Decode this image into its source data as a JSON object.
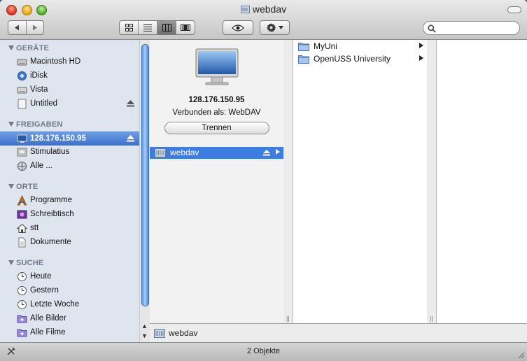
{
  "window": {
    "title": "webdav"
  },
  "toolbar": {
    "back": "back",
    "forward": "forward",
    "views": [
      "icon-view",
      "list-view",
      "column-view",
      "coverflow-view"
    ],
    "active_view": "column-view",
    "search_placeholder": ""
  },
  "sidebar": {
    "sections": [
      {
        "title": "GERÄTE",
        "items": [
          {
            "label": "Macintosh HD",
            "icon": "hard-drive-icon"
          },
          {
            "label": "iDisk",
            "icon": "idisk-icon"
          },
          {
            "label": "Vista",
            "icon": "disk-icon"
          },
          {
            "label": "Untitled",
            "icon": "disk-icon",
            "eject": true
          }
        ]
      },
      {
        "title": "FREIGABEN",
        "items": [
          {
            "label": "128.176.150.95",
            "icon": "server-icon",
            "eject": true,
            "selected": true
          },
          {
            "label": "Stimulatius",
            "icon": "computer-icon"
          },
          {
            "label": "Alle ...",
            "icon": "network-icon"
          }
        ]
      },
      {
        "title": "ORTE",
        "items": [
          {
            "label": "Programme",
            "icon": "applications-icon"
          },
          {
            "label": "Schreibtisch",
            "icon": "desktop-icon"
          },
          {
            "label": "stt",
            "icon": "home-icon"
          },
          {
            "label": "Dokumente",
            "icon": "documents-icon"
          }
        ]
      },
      {
        "title": "SUCHE",
        "items": [
          {
            "label": "Heute",
            "icon": "clock-icon"
          },
          {
            "label": "Gestern",
            "icon": "clock-icon"
          },
          {
            "label": "Letzte Woche",
            "icon": "clock-icon"
          },
          {
            "label": "Alle Bilder",
            "icon": "smart-folder-icon"
          },
          {
            "label": "Alle Filme",
            "icon": "smart-folder-icon"
          }
        ]
      }
    ]
  },
  "server": {
    "address": "128.176.150.95",
    "connected_as": "Verbunden als: WebDAV",
    "disconnect_label": "Trennen"
  },
  "column1": {
    "items": [
      {
        "label": "webdav",
        "selected": true,
        "eject": true
      }
    ]
  },
  "column2": {
    "items": [
      {
        "label": "MyUni"
      },
      {
        "label": "OpenUSS University"
      }
    ]
  },
  "pathbar": {
    "label": "webdav"
  },
  "status": {
    "text": "2 Objekte"
  },
  "colors": {
    "selection": "#3d7ce0",
    "sidebar_bg": "#dfe5ee",
    "folder_blue": "#8fb3e6"
  }
}
